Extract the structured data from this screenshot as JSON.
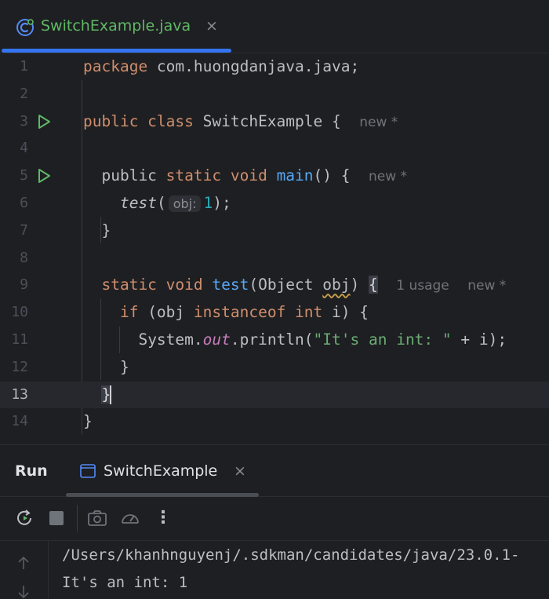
{
  "editor_tab": {
    "file_name": "SwitchExample.java",
    "close_glyph": "×",
    "icon": "java-class-icon"
  },
  "code": {
    "line_numbers": [
      "1",
      "2",
      "3",
      "4",
      "5",
      "6",
      "7",
      "8",
      "9",
      "10",
      "11",
      "12",
      "13",
      "14"
    ],
    "l1": {
      "kw": "package",
      "rest": " com.huongdanjava.java;"
    },
    "l3": {
      "kw": "public class",
      "name": " SwitchExample {",
      "hint": "new *"
    },
    "l5": {
      "kw1": "public",
      "kw2": " static void ",
      "fn": "main",
      "rest": "() {",
      "hint": "new *"
    },
    "l6": {
      "fn": "test",
      "open": "(",
      "param_hint": "obj:",
      "num": "1",
      "close": ");"
    },
    "l7": {
      "text": "}"
    },
    "l9": {
      "kw": "static void ",
      "fn": "test",
      "open": "(Object ",
      "var": "obj",
      "close": ") ",
      "brace": "{",
      "hint_usage": "1 usage",
      "hint_new": "new *"
    },
    "l10": {
      "kw1": "if",
      "mid": " (obj ",
      "kw2": "instanceof",
      "kw3": " int",
      "rest": " i) {"
    },
    "l11": {
      "pre": "System.",
      "field": "out",
      "mid": ".println(",
      "str": "\"It's an int: \"",
      "rest": " + i);"
    },
    "l12": {
      "text": "}"
    },
    "l13": {
      "text": "}"
    },
    "l14": {
      "text": "}"
    }
  },
  "run_panel": {
    "title": "Run",
    "tab_name": "SwitchExample",
    "close_glyph": "×",
    "toolbar_icons": [
      "rerun-icon",
      "stop-icon",
      "camera-icon",
      "profiler-icon",
      "more-icon"
    ],
    "more_glyph": "⋮",
    "console_lines": [
      "/Users/khanhnguyenj/.sdkman/candidates/java/23.0.1-",
      "It's an int: 1"
    ]
  },
  "colors": {
    "accent": "#3574f0",
    "run_green": "#5fb865",
    "keyword": "#cf8e6d",
    "function": "#56a8f5",
    "number": "#2aacb8",
    "string": "#6aab73",
    "static_field": "#c77dbb"
  }
}
